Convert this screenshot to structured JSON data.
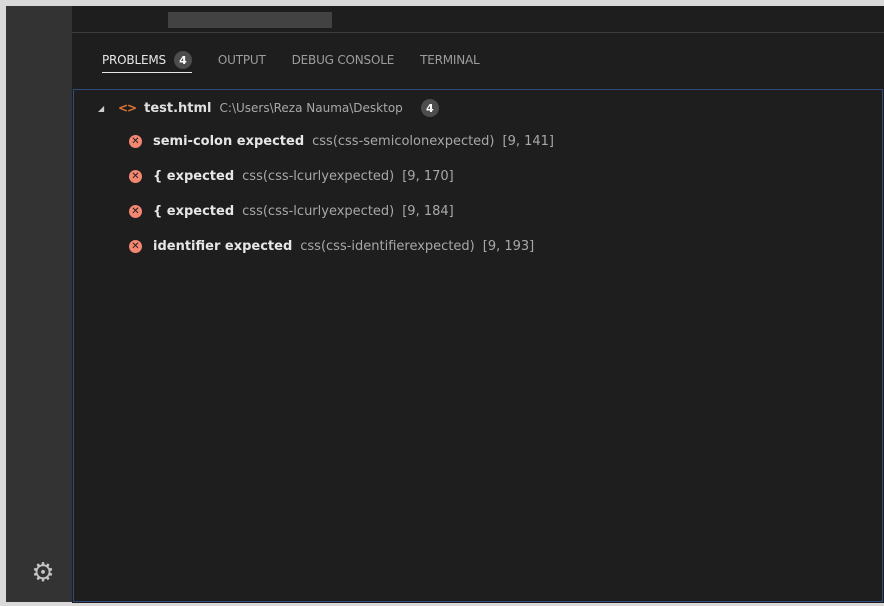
{
  "panel": {
    "tabs": [
      {
        "label": "PROBLEMS",
        "badge": "4"
      },
      {
        "label": "OUTPUT"
      },
      {
        "label": "DEBUG CONSOLE"
      },
      {
        "label": "TERMINAL"
      }
    ]
  },
  "file": {
    "name": "test.html",
    "path": "C:\\Users\\Reza Nauma\\Desktop",
    "count": "4"
  },
  "problems": [
    {
      "message": "semi-colon expected",
      "code": "css(css-semicolonexpected)",
      "position": "[9, 141]"
    },
    {
      "message": "{ expected",
      "code": "css(css-lcurlyexpected)",
      "position": "[9, 170]"
    },
    {
      "message": "{ expected",
      "code": "css(css-lcurlyexpected)",
      "position": "[9, 184]"
    },
    {
      "message": "identifier expected",
      "code": "css(css-identifierexpected)",
      "position": "[9, 193]"
    }
  ],
  "icons": {
    "gear": "gear-icon",
    "error": "error-icon",
    "file": "html-file-icon",
    "expand": "chevron-down-icon"
  },
  "colors": {
    "error": "#f48771",
    "html_icon": "#e37933",
    "focus_border": "#2f4d7a"
  }
}
